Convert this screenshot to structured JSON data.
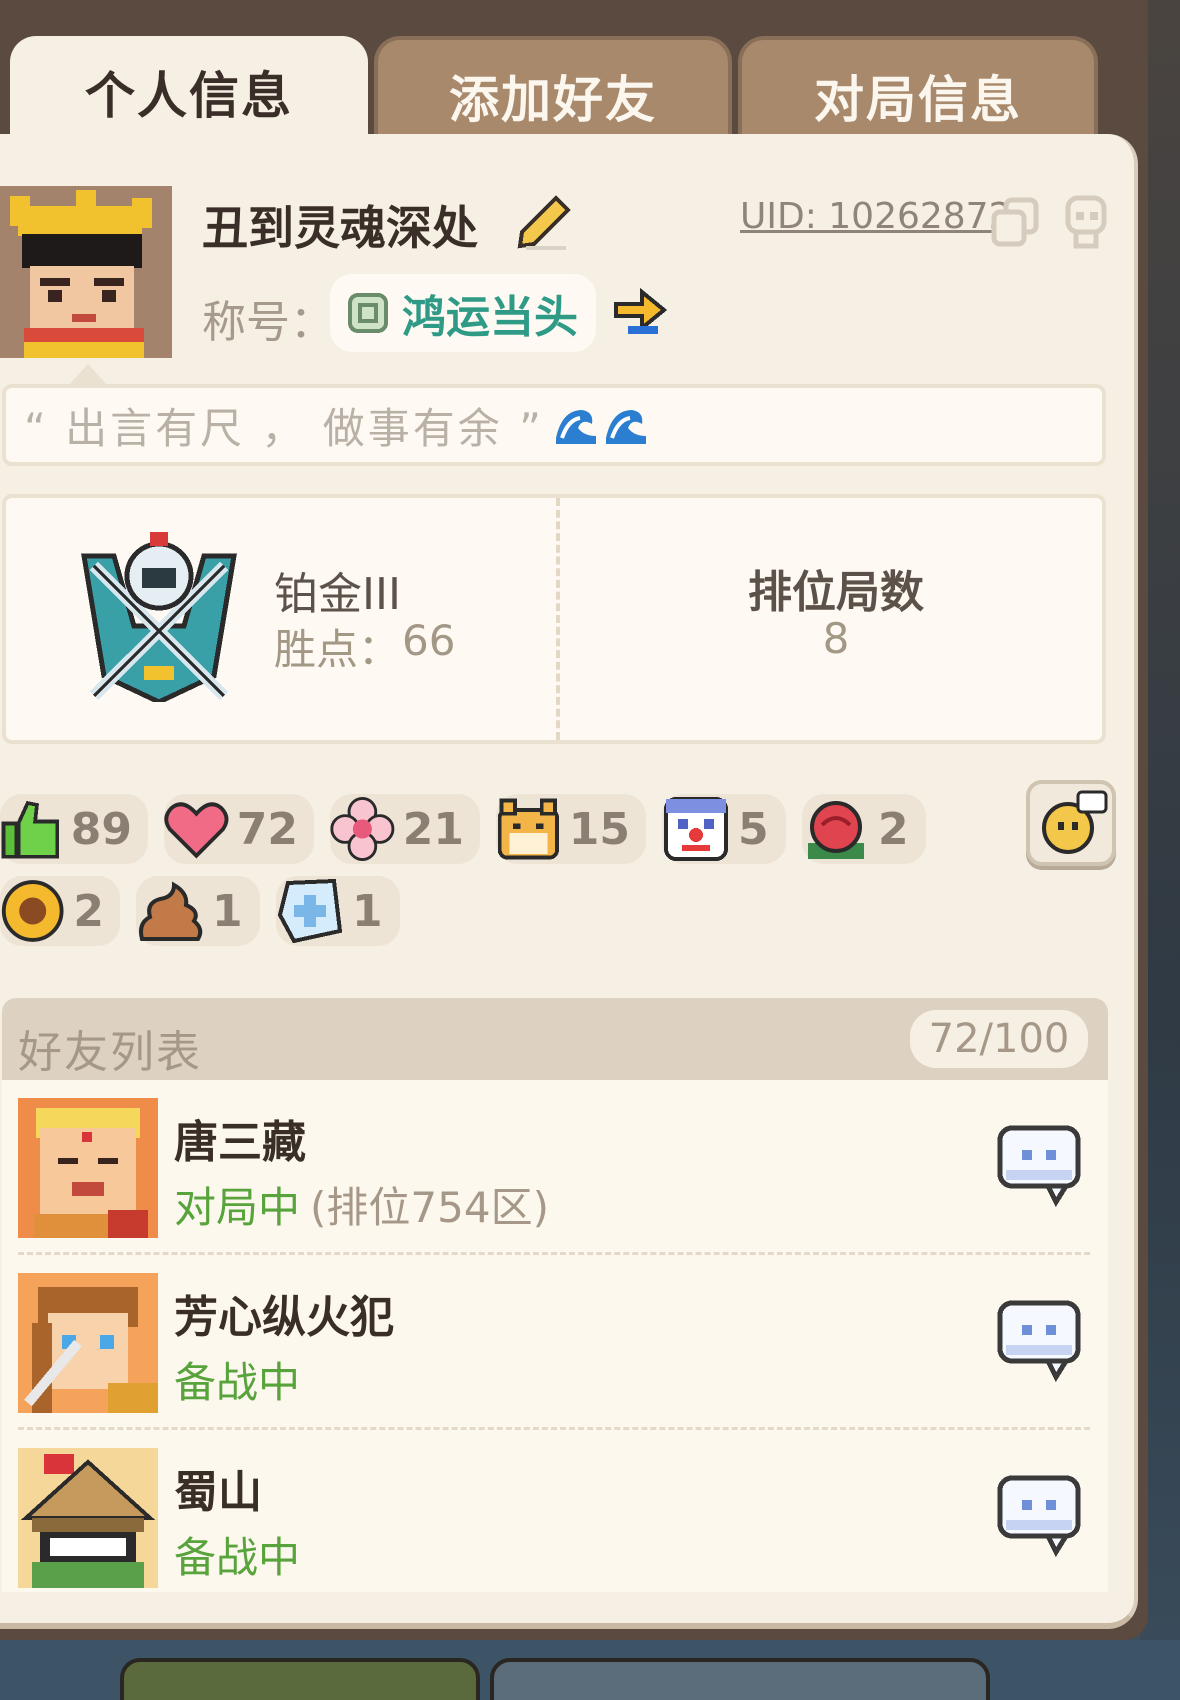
{
  "tabs": [
    {
      "label": "个人信息",
      "active": true
    },
    {
      "label": "添加好友",
      "active": false
    },
    {
      "label": "对局信息",
      "active": false
    }
  ],
  "profile": {
    "username": "丑到灵魂深处",
    "uid": "UID: 10262872",
    "title_label": "称号：",
    "title_value": "鸿运当头",
    "signature": "“ 出言有尺 ， 做事有余 ”"
  },
  "rank": {
    "tier": "铂金III",
    "points_label": "胜点：",
    "points_value": "66",
    "ranked_games_label": "排位局数",
    "ranked_games_value": "8"
  },
  "reactions": [
    {
      "icon": "thumbs-up-icon",
      "count": "89"
    },
    {
      "icon": "heart-icon",
      "count": "72"
    },
    {
      "icon": "flower-icon",
      "count": "21"
    },
    {
      "icon": "doge-icon",
      "count": "15"
    },
    {
      "icon": "clown-icon",
      "count": "5"
    },
    {
      "icon": "rose-icon",
      "count": "2"
    },
    {
      "icon": "sunflower-icon",
      "count": "2"
    },
    {
      "icon": "poop-icon",
      "count": "1"
    },
    {
      "icon": "ice-icon",
      "count": "1"
    }
  ],
  "friends": {
    "title": "好友列表",
    "count": "72/100",
    "items": [
      {
        "name": "唐三藏",
        "status": "对局中",
        "extra": "(排位754区)"
      },
      {
        "name": "芳心纵火犯",
        "status": "备战中",
        "extra": ""
      },
      {
        "name": "蜀山",
        "status": "备战中",
        "extra": ""
      }
    ]
  },
  "colors": {
    "panel": "#f6efe3",
    "tab_inactive": "#a9896c",
    "title_teal": "#2f9b86",
    "status_green": "#58a33b"
  }
}
